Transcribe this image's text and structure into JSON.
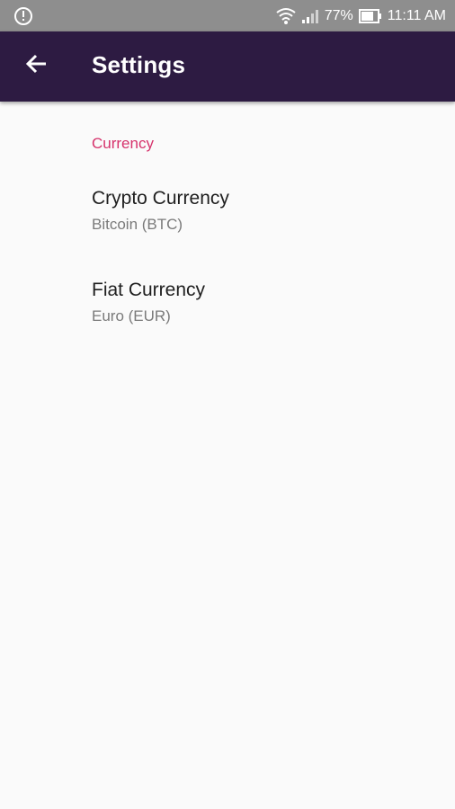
{
  "status_bar": {
    "battery_percent": "77%",
    "time": "11:11 AM",
    "icons": [
      "alert-circle-icon",
      "wifi-icon",
      "signal-icon",
      "battery-icon"
    ]
  },
  "app_bar": {
    "title": "Settings",
    "back_icon": "arrow-left-icon",
    "background_color": "#2d1b42"
  },
  "settings": {
    "section_title": "Currency",
    "section_color": "#d6336c",
    "items": [
      {
        "title": "Crypto Currency",
        "summary": "Bitcoin (BTC)"
      },
      {
        "title": "Fiat Currency",
        "summary": "Euro (EUR)"
      }
    ]
  }
}
